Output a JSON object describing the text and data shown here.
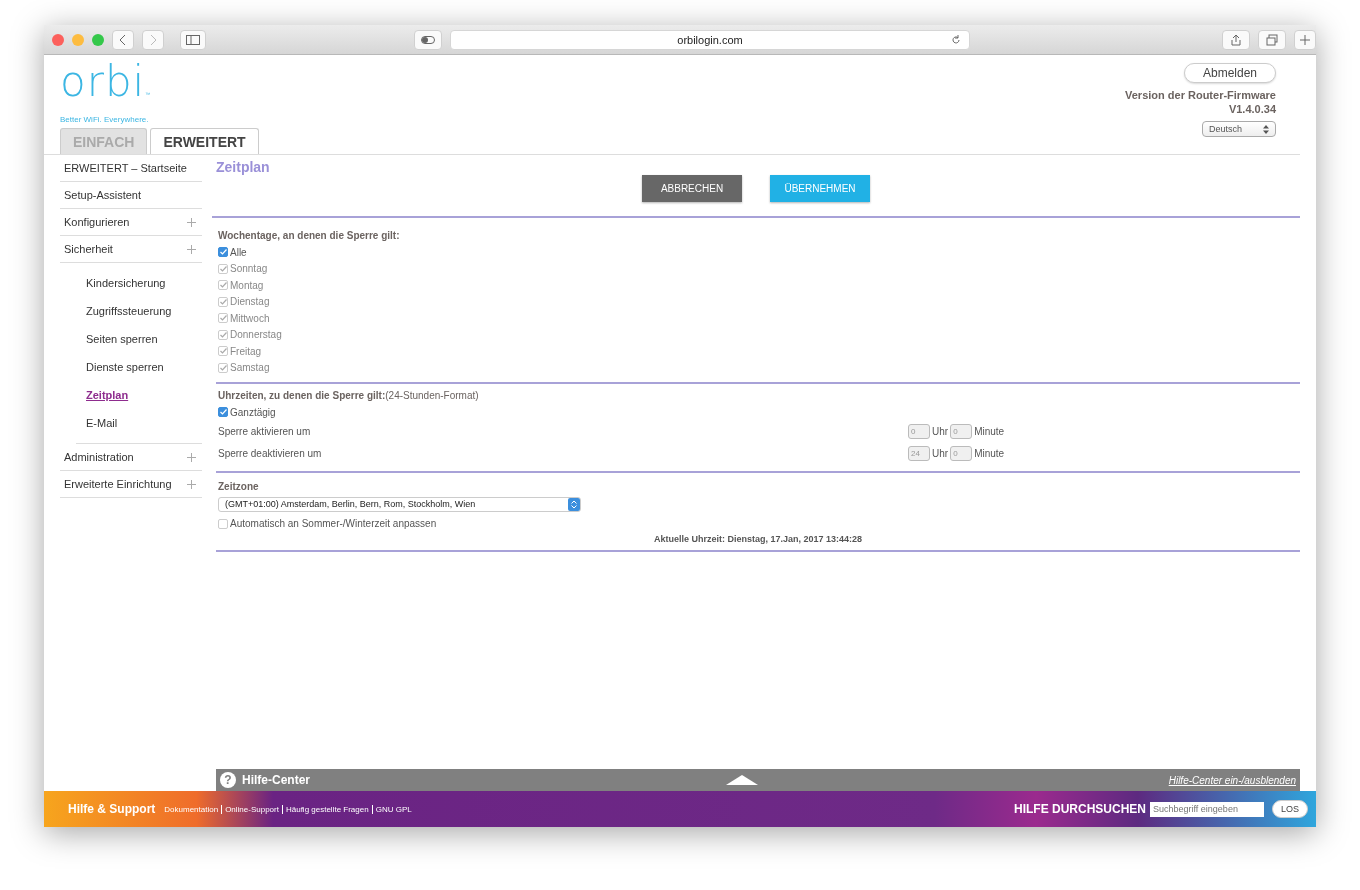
{
  "browser": {
    "url": "orbilogin.com"
  },
  "header": {
    "logo": "orbi",
    "logo_mark": "™",
    "tagline": "Better WiFi. Everywhere.",
    "logout": "Abmelden",
    "firmware_label": "Version der Router-Firmware",
    "firmware_version": "V1.4.0.34",
    "language": "Deutsch"
  },
  "tabs": [
    {
      "label": "EINFACH",
      "selected": false
    },
    {
      "label": "ERWEITERT",
      "selected": true
    }
  ],
  "sidebar": {
    "items": [
      {
        "label": "ERWEITERT – Startseite",
        "expandable": false,
        "selected": false
      },
      {
        "label": "Setup-Assistent",
        "expandable": false,
        "selected": false
      },
      {
        "label": "Konfigurieren",
        "expandable": true,
        "selected": false
      },
      {
        "label": "Sicherheit",
        "expandable": true,
        "selected": false,
        "children": [
          {
            "label": "Kindersicherung",
            "selected": false
          },
          {
            "label": "Zugriffssteuerung",
            "selected": false
          },
          {
            "label": "Seiten sperren",
            "selected": false
          },
          {
            "label": "Dienste sperren",
            "selected": false
          },
          {
            "label": "Zeitplan",
            "selected": true
          },
          {
            "label": "E-Mail",
            "selected": false
          }
        ]
      },
      {
        "label": "Administration",
        "expandable": true,
        "selected": false
      },
      {
        "label": "Erweiterte Einrichtung",
        "expandable": true,
        "selected": false
      }
    ]
  },
  "page": {
    "title": "Zeitplan",
    "buttons": [
      {
        "label": "ABBRECHEN",
        "kind": "cancel"
      },
      {
        "label": "ÜBERNEHMEN",
        "kind": "apply"
      }
    ],
    "days": {
      "heading": "Wochentage, an denen die Sperre gilt:",
      "items": [
        {
          "label": "Alle",
          "checked": true,
          "disabled": false
        },
        {
          "label": "Sonntag",
          "checked": true,
          "disabled": true
        },
        {
          "label": "Montag",
          "checked": true,
          "disabled": true
        },
        {
          "label": "Dienstag",
          "checked": true,
          "disabled": true
        },
        {
          "label": "Mittwoch",
          "checked": true,
          "disabled": true
        },
        {
          "label": "Donnerstag",
          "checked": true,
          "disabled": true
        },
        {
          "label": "Freitag",
          "checked": true,
          "disabled": true
        },
        {
          "label": "Samstag",
          "checked": true,
          "disabled": true
        }
      ]
    },
    "times": {
      "heading": "Uhrzeiten, zu denen die Sperre gilt:",
      "heading_note": "(24-Stunden-Format)",
      "all_day": {
        "label": "Ganztägig",
        "checked": true
      },
      "rows": [
        {
          "label": "Sperre aktivieren um",
          "hour": "0",
          "hour_unit": "Uhr",
          "minute": "0",
          "minute_unit": "Minute",
          "disabled": true
        },
        {
          "label": "Sperre deaktivieren um",
          "hour": "24",
          "hour_unit": "Uhr",
          "minute": "0",
          "minute_unit": "Minute",
          "disabled": true
        }
      ]
    },
    "timezone": {
      "heading": "Zeitzone",
      "value": "(GMT+01:00) Amsterdam, Berlin, Bern, Rom, Stockholm, Wien",
      "dst": {
        "label": "Automatisch an Sommer-/Winterzeit anpassen",
        "checked": false
      },
      "current_time": "Aktuelle Uhrzeit: Dienstag, 17.Jan, 2017 13:44:28"
    }
  },
  "help_bar": {
    "icon": "?",
    "title": "Hilfe-Center",
    "toggle": "Hilfe-Center ein-/ausblenden"
  },
  "footer": {
    "title": "Hilfe & Support",
    "links": [
      "Dokumentation",
      "Online-Support",
      "Häufig gestellte Fragen",
      "GNU GPL"
    ],
    "search_label": "HILFE DURCHSUCHEN",
    "search_placeholder": "Suchbegriff eingeben",
    "search_button": "LOS"
  }
}
